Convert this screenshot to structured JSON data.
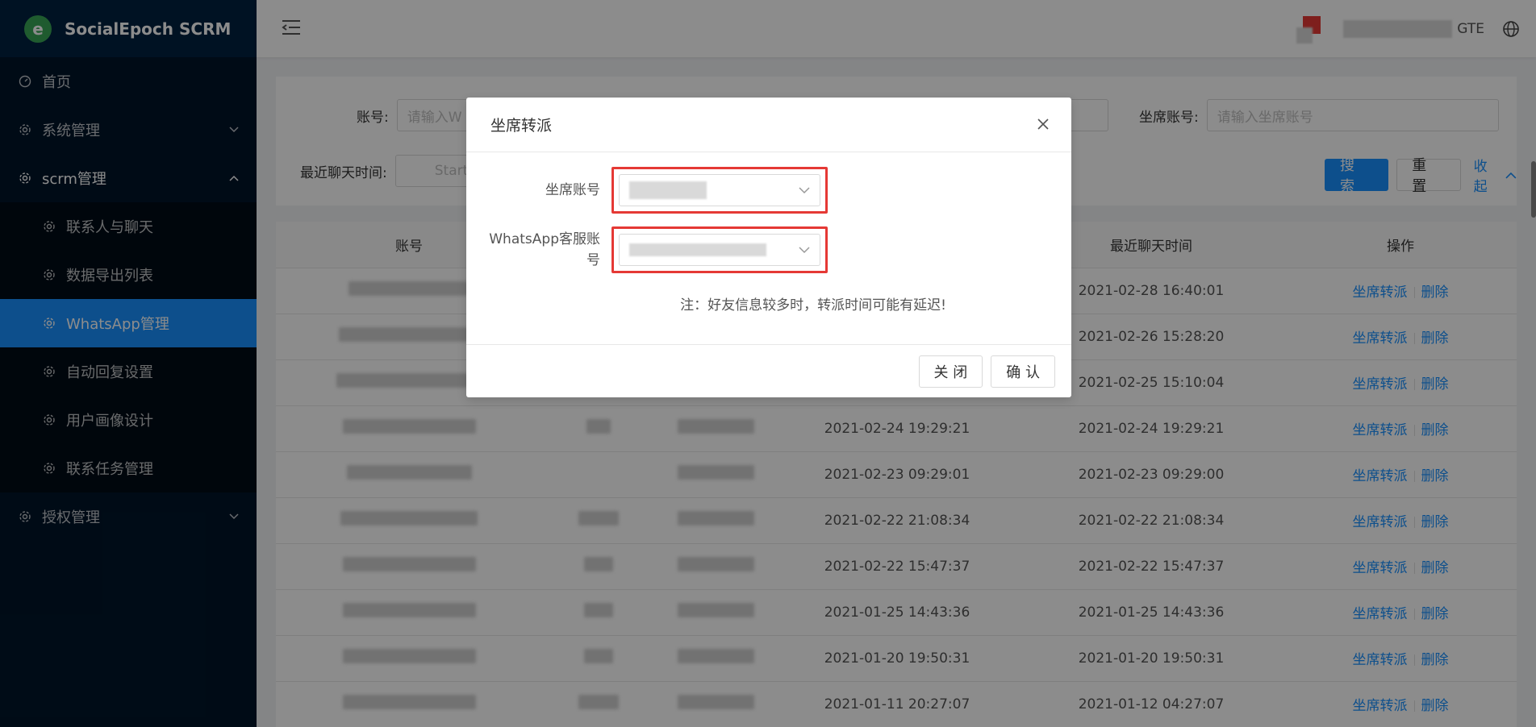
{
  "app": {
    "title": "SocialEpoch SCRM",
    "logo_letter": "e"
  },
  "sidebar": {
    "items": [
      {
        "label": "首页"
      },
      {
        "label": "系统管理"
      },
      {
        "label": "scrm管理"
      },
      {
        "label": "联系人与聊天"
      },
      {
        "label": "数据导出列表"
      },
      {
        "label": "WhatsApp管理"
      },
      {
        "label": "自动回复设置"
      },
      {
        "label": "用户画像设计"
      },
      {
        "label": "联系任务管理"
      },
      {
        "label": "授权管理"
      }
    ]
  },
  "header": {
    "user_suffix": "GTE"
  },
  "search": {
    "account_label": "账号:",
    "account_placeholder": "请输入W",
    "seat_label": "坐席账号:",
    "seat_placeholder": "请输入坐席账号",
    "last_chat_label": "最近聊天时间:",
    "start_placeholder": "Start",
    "search_btn": "搜 索",
    "reset_btn": "重 置",
    "collapse_link": "收起"
  },
  "table": {
    "headers": [
      "账号",
      "",
      "",
      "",
      "最近聊天时间",
      "操作"
    ],
    "rows": [
      {
        "col4": "",
        "last": "2021-02-28 16:40:01"
      },
      {
        "col4": "",
        "last": "2021-02-26 15:28:20"
      },
      {
        "col4": "",
        "last": "2021-02-25 15:10:04"
      },
      {
        "col4": "2021-02-24 19:29:21",
        "last": "2021-02-24 19:29:21"
      },
      {
        "col4": "2021-02-23 09:29:01",
        "last": "2021-02-23 09:29:00"
      },
      {
        "col4": "2021-02-22 21:08:34",
        "last": "2021-02-22 21:08:34"
      },
      {
        "col4": "2021-02-22 15:47:37",
        "last": "2021-02-22 15:47:37"
      },
      {
        "col4": "2021-01-25 14:43:36",
        "last": "2021-01-25 14:43:36"
      },
      {
        "col4": "2021-01-20 19:50:31",
        "last": "2021-01-20 19:50:31"
      },
      {
        "col4": "2021-01-11 20:27:07",
        "last": "2021-01-12 04:27:07"
      }
    ],
    "op_transfer": "坐席转派",
    "op_delete": "删除"
  },
  "modal": {
    "title": "坐席转派",
    "seat_label": "坐席账号",
    "wa_label_line1": "WhatsApp客服账",
    "wa_label_line2": "号",
    "note": "注：好友信息较多时，转派时间可能有延迟!",
    "close_btn": "关 闭",
    "confirm_btn": "确 认"
  },
  "colors": {
    "primary": "#1890ff",
    "sidebar_bg": "#001529",
    "highlight_border": "#e53935"
  }
}
